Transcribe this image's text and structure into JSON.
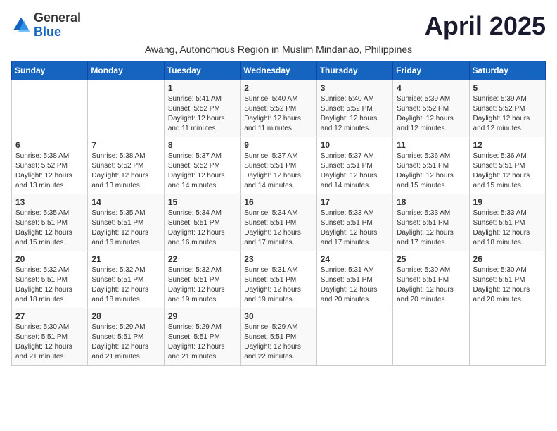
{
  "logo": {
    "general": "General",
    "blue": "Blue"
  },
  "title": "April 2025",
  "subtitle": "Awang, Autonomous Region in Muslim Mindanao, Philippines",
  "days": [
    "Sunday",
    "Monday",
    "Tuesday",
    "Wednesday",
    "Thursday",
    "Friday",
    "Saturday"
  ],
  "weeks": [
    [
      {
        "day": "",
        "info": ""
      },
      {
        "day": "",
        "info": ""
      },
      {
        "day": "1",
        "info": "Sunrise: 5:41 AM\nSunset: 5:52 PM\nDaylight: 12 hours and 11 minutes."
      },
      {
        "day": "2",
        "info": "Sunrise: 5:40 AM\nSunset: 5:52 PM\nDaylight: 12 hours and 11 minutes."
      },
      {
        "day": "3",
        "info": "Sunrise: 5:40 AM\nSunset: 5:52 PM\nDaylight: 12 hours and 12 minutes."
      },
      {
        "day": "4",
        "info": "Sunrise: 5:39 AM\nSunset: 5:52 PM\nDaylight: 12 hours and 12 minutes."
      },
      {
        "day": "5",
        "info": "Sunrise: 5:39 AM\nSunset: 5:52 PM\nDaylight: 12 hours and 12 minutes."
      }
    ],
    [
      {
        "day": "6",
        "info": "Sunrise: 5:38 AM\nSunset: 5:52 PM\nDaylight: 12 hours and 13 minutes."
      },
      {
        "day": "7",
        "info": "Sunrise: 5:38 AM\nSunset: 5:52 PM\nDaylight: 12 hours and 13 minutes."
      },
      {
        "day": "8",
        "info": "Sunrise: 5:37 AM\nSunset: 5:52 PM\nDaylight: 12 hours and 14 minutes."
      },
      {
        "day": "9",
        "info": "Sunrise: 5:37 AM\nSunset: 5:51 PM\nDaylight: 12 hours and 14 minutes."
      },
      {
        "day": "10",
        "info": "Sunrise: 5:37 AM\nSunset: 5:51 PM\nDaylight: 12 hours and 14 minutes."
      },
      {
        "day": "11",
        "info": "Sunrise: 5:36 AM\nSunset: 5:51 PM\nDaylight: 12 hours and 15 minutes."
      },
      {
        "day": "12",
        "info": "Sunrise: 5:36 AM\nSunset: 5:51 PM\nDaylight: 12 hours and 15 minutes."
      }
    ],
    [
      {
        "day": "13",
        "info": "Sunrise: 5:35 AM\nSunset: 5:51 PM\nDaylight: 12 hours and 15 minutes."
      },
      {
        "day": "14",
        "info": "Sunrise: 5:35 AM\nSunset: 5:51 PM\nDaylight: 12 hours and 16 minutes."
      },
      {
        "day": "15",
        "info": "Sunrise: 5:34 AM\nSunset: 5:51 PM\nDaylight: 12 hours and 16 minutes."
      },
      {
        "day": "16",
        "info": "Sunrise: 5:34 AM\nSunset: 5:51 PM\nDaylight: 12 hours and 17 minutes."
      },
      {
        "day": "17",
        "info": "Sunrise: 5:33 AM\nSunset: 5:51 PM\nDaylight: 12 hours and 17 minutes."
      },
      {
        "day": "18",
        "info": "Sunrise: 5:33 AM\nSunset: 5:51 PM\nDaylight: 12 hours and 17 minutes."
      },
      {
        "day": "19",
        "info": "Sunrise: 5:33 AM\nSunset: 5:51 PM\nDaylight: 12 hours and 18 minutes."
      }
    ],
    [
      {
        "day": "20",
        "info": "Sunrise: 5:32 AM\nSunset: 5:51 PM\nDaylight: 12 hours and 18 minutes."
      },
      {
        "day": "21",
        "info": "Sunrise: 5:32 AM\nSunset: 5:51 PM\nDaylight: 12 hours and 18 minutes."
      },
      {
        "day": "22",
        "info": "Sunrise: 5:32 AM\nSunset: 5:51 PM\nDaylight: 12 hours and 19 minutes."
      },
      {
        "day": "23",
        "info": "Sunrise: 5:31 AM\nSunset: 5:51 PM\nDaylight: 12 hours and 19 minutes."
      },
      {
        "day": "24",
        "info": "Sunrise: 5:31 AM\nSunset: 5:51 PM\nDaylight: 12 hours and 20 minutes."
      },
      {
        "day": "25",
        "info": "Sunrise: 5:30 AM\nSunset: 5:51 PM\nDaylight: 12 hours and 20 minutes."
      },
      {
        "day": "26",
        "info": "Sunrise: 5:30 AM\nSunset: 5:51 PM\nDaylight: 12 hours and 20 minutes."
      }
    ],
    [
      {
        "day": "27",
        "info": "Sunrise: 5:30 AM\nSunset: 5:51 PM\nDaylight: 12 hours and 21 minutes."
      },
      {
        "day": "28",
        "info": "Sunrise: 5:29 AM\nSunset: 5:51 PM\nDaylight: 12 hours and 21 minutes."
      },
      {
        "day": "29",
        "info": "Sunrise: 5:29 AM\nSunset: 5:51 PM\nDaylight: 12 hours and 21 minutes."
      },
      {
        "day": "30",
        "info": "Sunrise: 5:29 AM\nSunset: 5:51 PM\nDaylight: 12 hours and 22 minutes."
      },
      {
        "day": "",
        "info": ""
      },
      {
        "day": "",
        "info": ""
      },
      {
        "day": "",
        "info": ""
      }
    ]
  ]
}
